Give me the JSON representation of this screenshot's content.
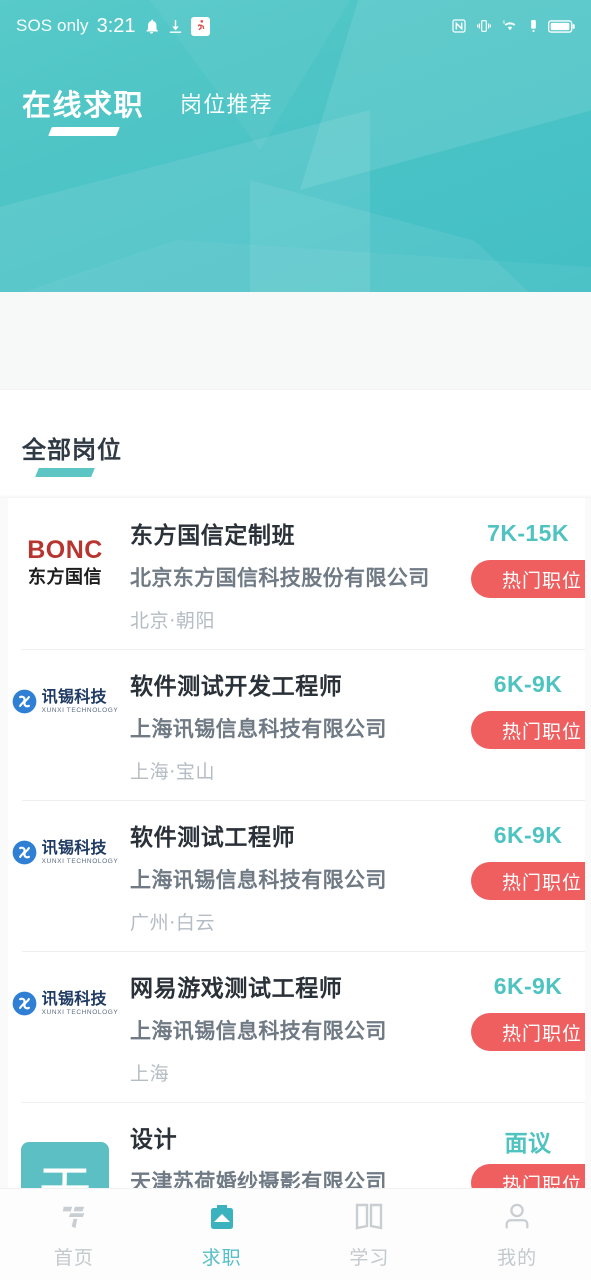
{
  "statusbar": {
    "carrier": "SOS only",
    "time": "3:21",
    "left_icons": [
      "bell-icon",
      "download-icon",
      "running-app-icon"
    ],
    "right_icons": [
      "nfc-icon",
      "vibrate-icon",
      "wifi-6-icon",
      "signal-alert-icon",
      "battery-icon"
    ]
  },
  "header": {
    "tabs": [
      {
        "label": "在线求职",
        "active": true
      },
      {
        "label": "岗位推荐",
        "active": false
      }
    ],
    "accent_color": "#4ec4c6"
  },
  "section": {
    "title": "全部岗位",
    "underline_color": "#5dc6c4"
  },
  "jobs": [
    {
      "title": "东方国信定制班",
      "company": "北京东方国信科技股份有限公司",
      "location": "北京·朝阳",
      "salary": "7K-15K",
      "badge": "热门职位",
      "logo_type": "bonc",
      "logo_top": "BONC",
      "logo_bottom": "东方国信"
    },
    {
      "title": "软件测试开发工程师",
      "company": "上海讯锡信息科技有限公司",
      "location": "上海·宝山",
      "salary": "6K-9K",
      "badge": "热门职位",
      "logo_type": "xunxi",
      "logo_cn": "讯锡科技",
      "logo_en": "XUNXI TECHNOLOGY"
    },
    {
      "title": "软件测试工程师",
      "company": "上海讯锡信息科技有限公司",
      "location": "广州·白云",
      "salary": "6K-9K",
      "badge": "热门职位",
      "logo_type": "xunxi",
      "logo_cn": "讯锡科技",
      "logo_en": "XUNXI TECHNOLOGY"
    },
    {
      "title": "网易游戏测试工程师",
      "company": "上海讯锡信息科技有限公司",
      "location": "上海",
      "salary": "6K-9K",
      "badge": "热门职位",
      "logo_type": "xunxi",
      "logo_cn": "讯锡科技",
      "logo_en": "XUNXI TECHNOLOGY"
    },
    {
      "title": "设计",
      "company": "天津苏荷婚纱摄影有限公司",
      "location": "",
      "salary": "面议",
      "badge": "热门职位",
      "logo_type": "square",
      "logo_letter": "天",
      "logo_color": "#5bbfc4"
    }
  ],
  "bottom_nav": {
    "items": [
      {
        "label": "首页",
        "icon": "home-glyph-icon",
        "active": false
      },
      {
        "label": "求职",
        "icon": "briefcase-icon",
        "active": true
      },
      {
        "label": "学习",
        "icon": "book-icon",
        "active": false
      },
      {
        "label": "我的",
        "icon": "person-icon",
        "active": false
      }
    ],
    "active_color": "#56c0c6",
    "inactive_color": "#c3c9cd"
  },
  "colors": {
    "salary": "#4ec3c0",
    "badge": "#ef5f5f",
    "title": "#2b3138"
  }
}
